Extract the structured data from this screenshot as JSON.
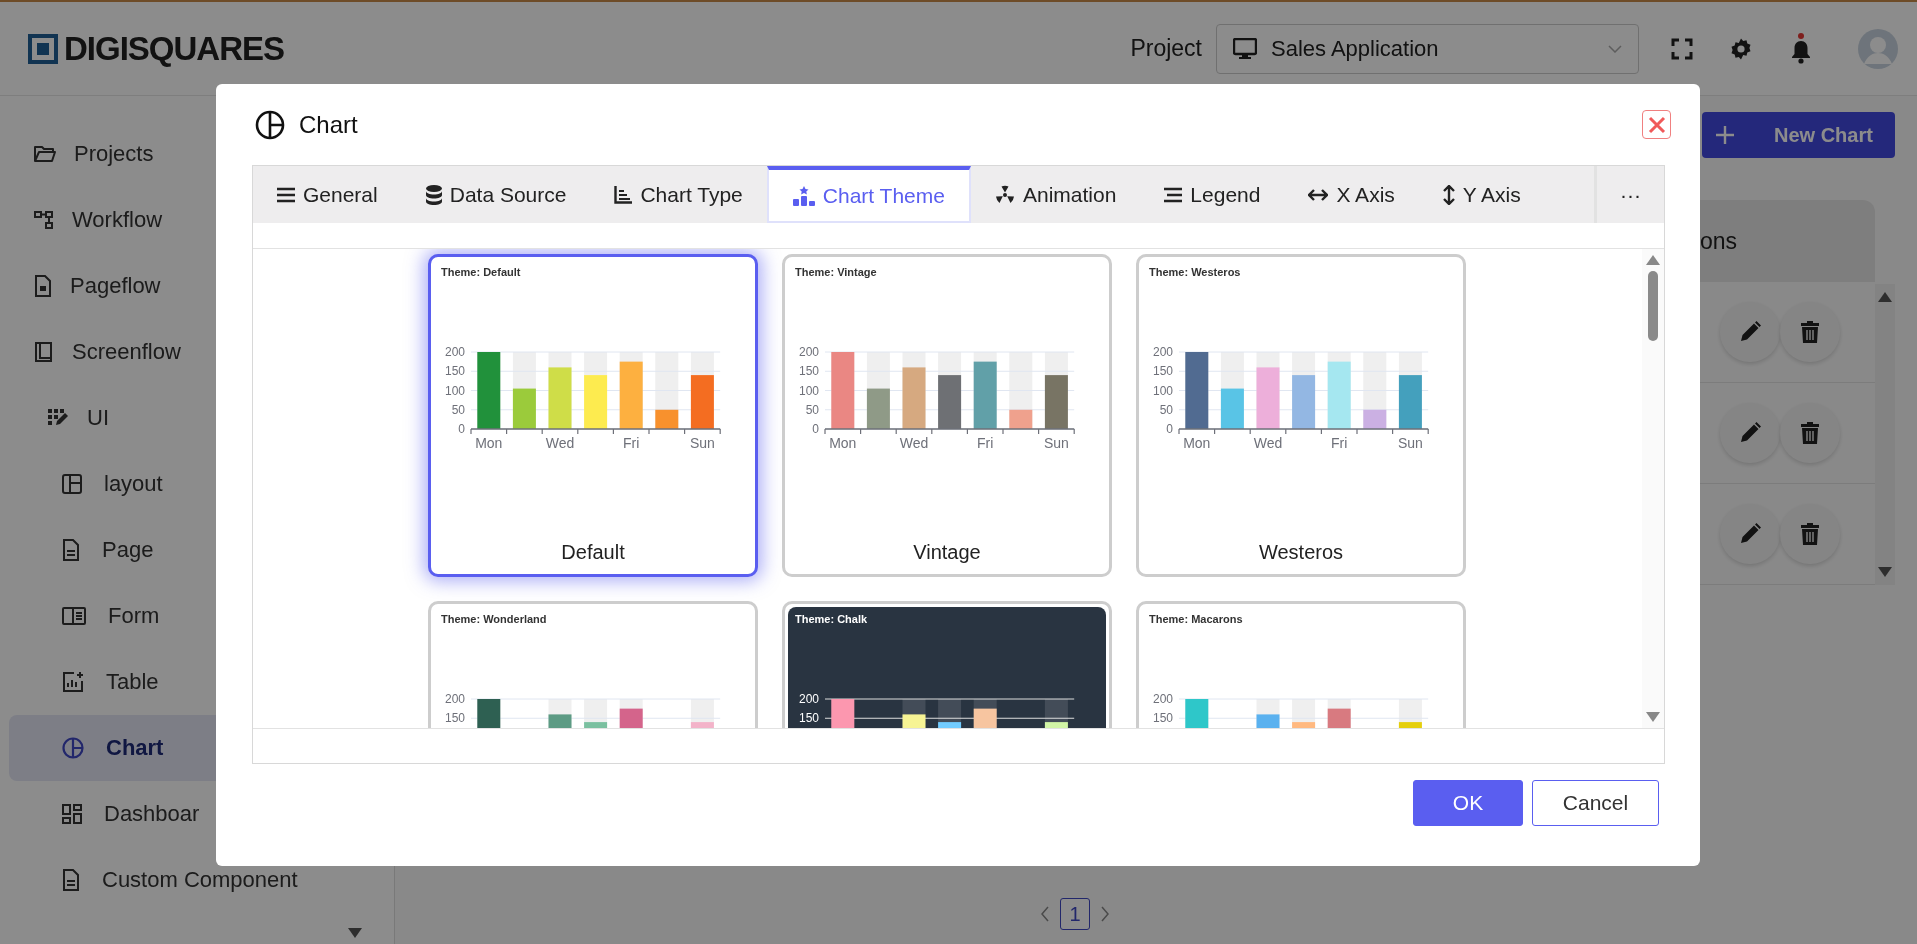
{
  "header": {
    "logo": "DIGISQUARES",
    "project_label": "Project",
    "project_select": {
      "value": "Sales Application"
    }
  },
  "sidebar": {
    "items": [
      {
        "label": "Projects",
        "selected": false
      },
      {
        "label": "Workflow",
        "selected": false
      },
      {
        "label": "Pageflow",
        "selected": false
      },
      {
        "label": "Screenflow",
        "selected": false
      },
      {
        "label": "UI",
        "selected": false,
        "children": [
          {
            "label": "layout",
            "selected": false
          },
          {
            "label": "Page",
            "selected": false
          },
          {
            "label": "Form",
            "selected": false
          },
          {
            "label": "Table",
            "selected": false
          },
          {
            "label": "Chart",
            "selected": true
          },
          {
            "label": "Dashboar",
            "selected": false
          },
          {
            "label": "Custom Component",
            "selected": false
          }
        ]
      }
    ]
  },
  "main": {
    "new_chart_button": "New Chart",
    "table": {
      "header": "ons",
      "rows": [
        {
          "kind": "actions"
        },
        {
          "kind": "actions"
        },
        {
          "kind": "actions"
        }
      ]
    },
    "pagination": {
      "pages": [
        {
          "label": "1",
          "selected": true
        }
      ]
    }
  },
  "dialog": {
    "title": "Chart",
    "tabs": [
      {
        "label": "General",
        "selected": false
      },
      {
        "label": "Data Source",
        "selected": false
      },
      {
        "label": "Chart Type",
        "selected": false
      },
      {
        "label": "Chart Theme",
        "selected": true
      },
      {
        "label": "Animation",
        "selected": false
      },
      {
        "label": "Legend",
        "selected": false
      },
      {
        "label": "X Axis",
        "selected": false
      },
      {
        "label": "Y Axis",
        "selected": false
      },
      {
        "label": "···",
        "selected": false
      }
    ],
    "themes": [
      {
        "name": "Default",
        "selected": true,
        "dark": false,
        "chart_data": {
          "type": "bar",
          "title": "Theme: Default",
          "categories": [
            "Mon",
            null,
            "Wed",
            null,
            "Fri",
            null,
            "Sun"
          ],
          "grid": true,
          "ylim": [
            0,
            200
          ],
          "yticks": [
            0,
            50,
            100,
            150,
            200
          ],
          "series": [
            {
              "color": "#21913b",
              "values": [
                200,
                null,
                null,
                null,
                null,
                null,
                null
              ]
            },
            {
              "color": "#9bcb3b",
              "values": [
                null,
                105,
                null,
                null,
                null,
                null,
                null
              ]
            },
            {
              "color": "#cfdd48",
              "values": [
                null,
                null,
                160,
                null,
                null,
                null,
                null
              ]
            },
            {
              "color": "#fdeb4f",
              "values": [
                null,
                null,
                null,
                140,
                null,
                null,
                null
              ]
            },
            {
              "color": "#fdb040",
              "values": [
                null,
                null,
                null,
                null,
                175,
                null,
                null
              ]
            },
            {
              "color": "#f8912d",
              "values": [
                null,
                null,
                null,
                null,
                null,
                50,
                null
              ]
            },
            {
              "color": "#f46d21",
              "values": [
                null,
                null,
                null,
                null,
                null,
                null,
                140
              ]
            }
          ]
        }
      },
      {
        "name": "Vintage",
        "selected": false,
        "dark": false,
        "chart_data": {
          "type": "bar",
          "title": "Theme: Vintage",
          "categories": [
            "Mon",
            null,
            "Wed",
            null,
            "Fri",
            null,
            "Sun"
          ],
          "grid": true,
          "ylim": [
            0,
            200
          ],
          "yticks": [
            0,
            50,
            100,
            150,
            200
          ],
          "series": [
            {
              "color": "#ea8783",
              "values": [
                200,
                null,
                null,
                null,
                null,
                null,
                null
              ]
            },
            {
              "color": "#8f9a87",
              "values": [
                null,
                105,
                null,
                null,
                null,
                null,
                null
              ]
            },
            {
              "color": "#d6a980",
              "values": [
                null,
                null,
                160,
                null,
                null,
                null,
                null
              ]
            },
            {
              "color": "#6e7074",
              "values": [
                null,
                null,
                null,
                140,
                null,
                null,
                null
              ]
            },
            {
              "color": "#61a0a8",
              "values": [
                null,
                null,
                null,
                null,
                175,
                null,
                null
              ]
            },
            {
              "color": "#efa18d",
              "values": [
                null,
                null,
                null,
                null,
                null,
                50,
                null
              ]
            },
            {
              "color": "#787464",
              "values": [
                null,
                null,
                null,
                null,
                null,
                null,
                140
              ]
            }
          ]
        }
      },
      {
        "name": "Westeros",
        "selected": false,
        "dark": false,
        "chart_data": {
          "type": "bar",
          "title": "Theme: Westeros",
          "categories": [
            "Mon",
            null,
            "Wed",
            null,
            "Fri",
            null,
            "Sun"
          ],
          "grid": true,
          "ylim": [
            0,
            200
          ],
          "yticks": [
            0,
            50,
            100,
            150,
            200
          ],
          "series": [
            {
              "color": "#516b91",
              "values": [
                200,
                null,
                null,
                null,
                null,
                null,
                null
              ]
            },
            {
              "color": "#59c4e6",
              "values": [
                null,
                105,
                null,
                null,
                null,
                null,
                null
              ]
            },
            {
              "color": "#edafda",
              "values": [
                null,
                null,
                160,
                null,
                null,
                null,
                null
              ]
            },
            {
              "color": "#93b7e3",
              "values": [
                null,
                null,
                null,
                140,
                null,
                null,
                null
              ]
            },
            {
              "color": "#a5e7f0",
              "values": [
                null,
                null,
                null,
                null,
                175,
                null,
                null
              ]
            },
            {
              "color": "#cbb0e3",
              "values": [
                null,
                null,
                null,
                null,
                null,
                50,
                null
              ]
            },
            {
              "color": "#44a0bd",
              "values": [
                null,
                null,
                null,
                null,
                null,
                null,
                140
              ]
            }
          ]
        }
      },
      {
        "selected": false,
        "dark": false,
        "chart_data": {
          "type": "bar",
          "title": "Theme: Wonderland",
          "grid": true,
          "ylim": [
            0,
            200
          ],
          "yticks": [
            150,
            200
          ],
          "series": [
            {
              "color": "#2e6052",
              "values": [
                200,
                null,
                null,
                null,
                null,
                null,
                null
              ]
            },
            {
              "color": "#5d9b84",
              "values": [
                null,
                null,
                160,
                null,
                null,
                null,
                null
              ]
            },
            {
              "color": "#7bc0a0",
              "values": [
                null,
                null,
                null,
                140,
                null,
                null,
                null
              ]
            },
            {
              "color": "#d4648b",
              "values": [
                null,
                null,
                null,
                null,
                175,
                null,
                null
              ]
            },
            {
              "color": "#f3b3c9",
              "values": [
                null,
                null,
                null,
                null,
                null,
                null,
                140
              ]
            }
          ]
        }
      },
      {
        "selected": false,
        "dark": true,
        "chart_data": {
          "type": "bar",
          "title": "Theme: Chalk",
          "grid": true,
          "ylim": [
            0,
            200
          ],
          "yticks": [
            150,
            200
          ],
          "series": [
            {
              "color": "#fc97af",
              "values": [
                200,
                null,
                null,
                null,
                null,
                null,
                null
              ]
            },
            {
              "color": "#f7f494",
              "values": [
                null,
                null,
                160,
                null,
                null,
                null,
                null
              ]
            },
            {
              "color": "#72ccff",
              "values": [
                null,
                null,
                null,
                140,
                null,
                null,
                null
              ]
            },
            {
              "color": "#f7c5a0",
              "values": [
                null,
                null,
                null,
                null,
                175,
                null,
                null
              ]
            },
            {
              "color": "#d2f5a6",
              "values": [
                null,
                null,
                null,
                null,
                null,
                null,
                140
              ]
            }
          ]
        }
      },
      {
        "selected": false,
        "dark": false,
        "chart_data": {
          "type": "bar",
          "title": "Theme: Macarons",
          "grid": true,
          "ylim": [
            0,
            200
          ],
          "yticks": [
            150,
            200
          ],
          "series": [
            {
              "color": "#2ec7c9",
              "values": [
                200,
                null,
                null,
                null,
                null,
                null,
                null
              ]
            },
            {
              "color": "#5ab1ef",
              "values": [
                null,
                null,
                160,
                null,
                null,
                null,
                null
              ]
            },
            {
              "color": "#ffb980",
              "values": [
                null,
                null,
                null,
                140,
                null,
                null,
                null
              ]
            },
            {
              "color": "#d87a80",
              "values": [
                null,
                null,
                null,
                null,
                175,
                null,
                null
              ]
            },
            {
              "color": "#e5cf0d",
              "values": [
                null,
                null,
                null,
                null,
                null,
                null,
                140
              ]
            }
          ]
        }
      }
    ],
    "buttons": [
      {
        "label": "OK",
        "kind": "primary"
      },
      {
        "label": "Cancel",
        "kind": "secondary"
      }
    ]
  }
}
